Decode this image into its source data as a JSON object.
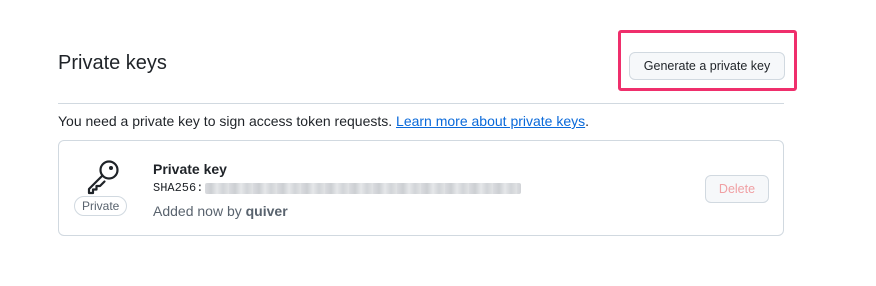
{
  "section": {
    "title": "Private keys",
    "generate_button_label": "Generate a private key"
  },
  "intro": {
    "text": "You need a private key to sign access token requests.",
    "link_text": "Learn more about private keys",
    "trailing": "."
  },
  "key": {
    "title": "Private key",
    "badge": "Private",
    "fingerprint_label": "SHA256:",
    "added_prefix": "Added now by",
    "added_by": "quiver",
    "delete_label": "Delete"
  },
  "icons": {
    "key": "key-icon"
  },
  "colors": {
    "highlight": "#ef2f6c",
    "link": "#0969da",
    "muted": "#59636e",
    "danger_disabled": "#f0a0a4"
  }
}
